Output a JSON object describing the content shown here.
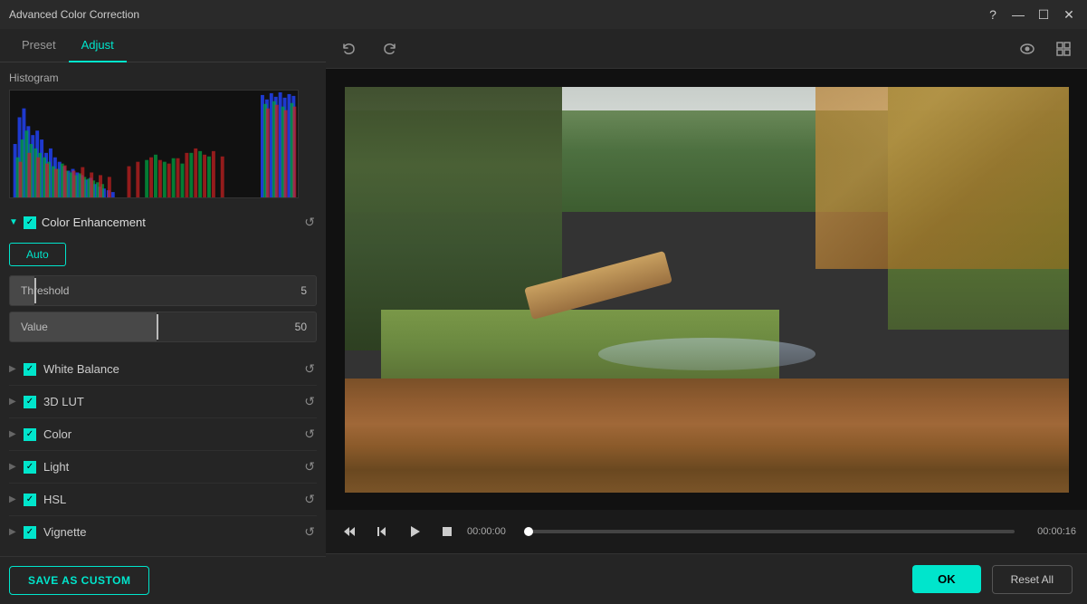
{
  "window": {
    "title": "Advanced Color Correction"
  },
  "tabs": {
    "preset": "Preset",
    "adjust": "Adjust",
    "active": "Adjust"
  },
  "histogram": {
    "label": "Histogram"
  },
  "colorEnhancement": {
    "name": "Color Enhancement",
    "enabled": true,
    "autoButton": "Auto",
    "threshold": {
      "label": "Threshold",
      "value": 5,
      "min": 0,
      "max": 100,
      "fillPercent": 8
    },
    "valueSlider": {
      "label": "Value",
      "value": 50,
      "min": 0,
      "max": 100,
      "fillPercent": 50
    }
  },
  "sections": [
    {
      "name": "White Balance",
      "enabled": true
    },
    {
      "name": "3D LUT",
      "enabled": true
    },
    {
      "name": "Color",
      "enabled": true
    },
    {
      "name": "Light",
      "enabled": true
    },
    {
      "name": "HSL",
      "enabled": true
    },
    {
      "name": "Vignette",
      "enabled": true
    }
  ],
  "toolbar": {
    "undoLabel": "↩",
    "redoLabel": "↪",
    "eyeIcon": "👁",
    "layoutIcon": "⊞"
  },
  "playback": {
    "currentTime": "00:00:00",
    "totalTime": "00:00:16",
    "progress": 0
  },
  "bottomBar": {
    "saveAsCustom": "SAVE AS CUSTOM",
    "ok": "OK",
    "resetAll": "Reset All"
  },
  "titlebarControls": {
    "help": "?",
    "minimize": "—",
    "maximize": "☐",
    "close": "✕"
  }
}
